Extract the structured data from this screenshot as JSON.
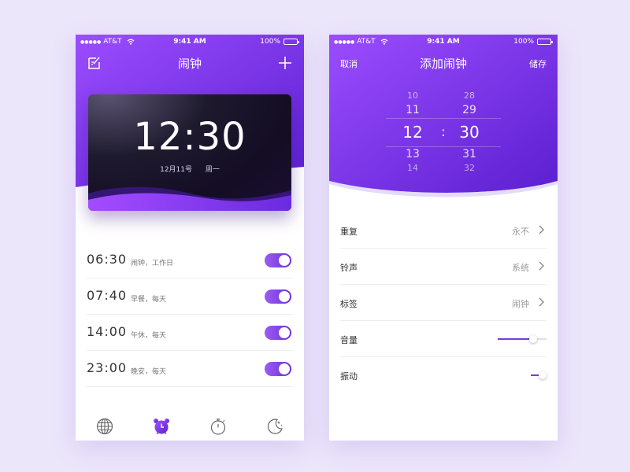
{
  "colors": {
    "page_background": "#ece6fb",
    "accent_light": "#9b4dff",
    "accent_dark": "#5b1fd0",
    "toggle_on": "#7a3ae0"
  },
  "status_bar": {
    "signal_dots": "●●●●●",
    "carrier": "AT&T",
    "time": "9:41 AM",
    "battery": "100%"
  },
  "alarm_screen": {
    "title": "闹钟",
    "edit_icon": "edit-icon",
    "add_icon": "plus-icon",
    "clock": {
      "time": "12:30",
      "date": "12月11号",
      "weekday": "周一"
    },
    "alarms": [
      {
        "time": "06:30",
        "label": "闹钟，工作日",
        "enabled": true
      },
      {
        "time": "07:40",
        "label": "早餐，每天",
        "enabled": true
      },
      {
        "time": "14:00",
        "label": "午休，每天",
        "enabled": true
      },
      {
        "time": "23:00",
        "label": "晚安，每天",
        "enabled": true
      }
    ],
    "tabs": [
      {
        "icon": "globe-icon",
        "active": false
      },
      {
        "icon": "alarm-clock-icon",
        "active": true
      },
      {
        "icon": "stopwatch-icon",
        "active": false
      },
      {
        "icon": "moon-icon",
        "active": false
      }
    ]
  },
  "add_alarm_screen": {
    "title": "添加闹钟",
    "cancel_label": "取消",
    "save_label": "储存",
    "picker": {
      "hours": [
        "10",
        "11",
        "12",
        "13",
        "14"
      ],
      "minutes": [
        "28",
        "29",
        "30",
        "31",
        "32"
      ],
      "separator": ":"
    },
    "settings": {
      "repeat": {
        "label": "重复",
        "value": "永不"
      },
      "ringtone": {
        "label": "铃声",
        "value": "系统"
      },
      "tag": {
        "label": "标签",
        "value": "闹钟"
      },
      "volume": {
        "label": "音量",
        "level": 0.72
      },
      "vibration": {
        "label": "振动",
        "level": 0.75
      }
    }
  }
}
